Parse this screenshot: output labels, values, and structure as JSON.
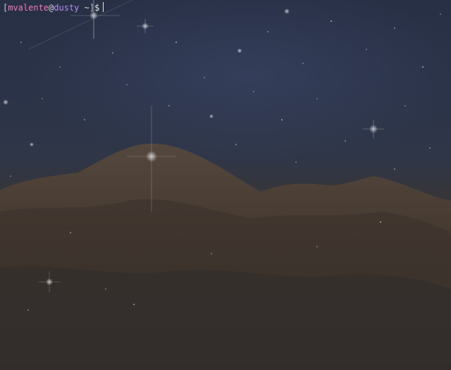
{
  "terminal": {
    "prompt": {
      "open_bracket": "[",
      "user": "mvalente",
      "at": "@",
      "host": "dusty",
      "cwd": "~",
      "close_bracket": "]",
      "symbol": "$"
    }
  },
  "colors": {
    "user": "#f07ab4",
    "host": "#b58cf2",
    "text": "#d8d8d8",
    "sky": "#283046",
    "nebula": "#3a3532"
  }
}
